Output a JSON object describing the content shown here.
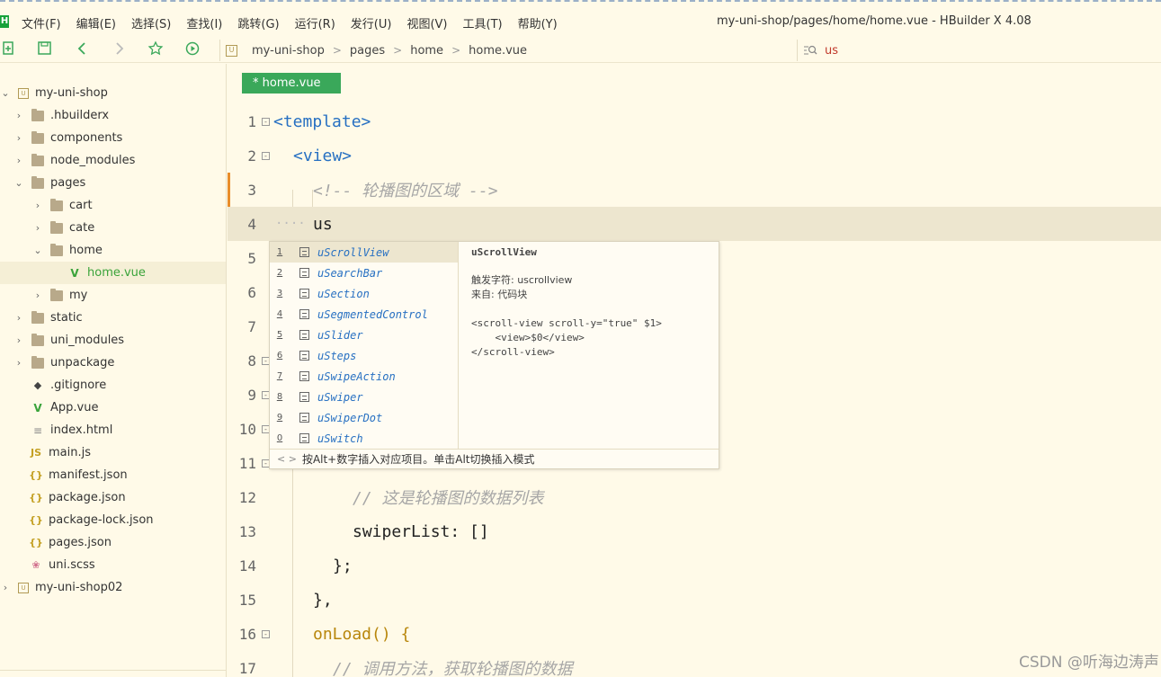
{
  "window": {
    "title": "my-uni-shop/pages/home/home.vue - HBuilder X 4.08",
    "menu": [
      "文件(F)",
      "编辑(E)",
      "选择(S)",
      "查找(I)",
      "跳转(G)",
      "运行(R)",
      "发行(U)",
      "视图(V)",
      "工具(T)",
      "帮助(Y)"
    ]
  },
  "breadcrumb": [
    "my-uni-shop",
    "pages",
    "home",
    "home.vue"
  ],
  "search": {
    "value": "us"
  },
  "sidebar": {
    "items": [
      {
        "label": "my-uni-shop",
        "icon": "project-icon",
        "chevron": "v"
      },
      {
        "label": ".hbuilderx",
        "icon": "folder-icon",
        "chevron": ">"
      },
      {
        "label": "components",
        "icon": "folder-icon",
        "chevron": ">"
      },
      {
        "label": "node_modules",
        "icon": "folder-icon",
        "chevron": ">"
      },
      {
        "label": "pages",
        "icon": "folder-icon",
        "chevron": "v"
      },
      {
        "label": "cart",
        "icon": "folder-icon",
        "chevron": ">"
      },
      {
        "label": "cate",
        "icon": "folder-icon",
        "chevron": ">"
      },
      {
        "label": "home",
        "icon": "folder-icon",
        "chevron": "v"
      },
      {
        "label": "home.vue",
        "icon": "vue-icon",
        "chevron": ""
      },
      {
        "label": "my",
        "icon": "folder-icon",
        "chevron": ">"
      },
      {
        "label": "static",
        "icon": "folder-icon",
        "chevron": ">"
      },
      {
        "label": "uni_modules",
        "icon": "folder-icon",
        "chevron": ">"
      },
      {
        "label": "unpackage",
        "icon": "folder-icon",
        "chevron": ">"
      },
      {
        "label": ".gitignore",
        "icon": "git-icon",
        "chevron": ""
      },
      {
        "label": "App.vue",
        "icon": "vue-icon",
        "chevron": ""
      },
      {
        "label": "index.html",
        "icon": "html-icon",
        "chevron": ""
      },
      {
        "label": "main.js",
        "icon": "js-icon",
        "chevron": ""
      },
      {
        "label": "manifest.json",
        "icon": "json-icon",
        "chevron": ""
      },
      {
        "label": "package.json",
        "icon": "json-icon",
        "chevron": ""
      },
      {
        "label": "package-lock.json",
        "icon": "json-icon",
        "chevron": ""
      },
      {
        "label": "pages.json",
        "icon": "json-icon",
        "chevron": ""
      },
      {
        "label": "uni.scss",
        "icon": "scss-icon",
        "chevron": ""
      },
      {
        "label": "my-uni-shop02",
        "icon": "project-icon",
        "chevron": ">"
      }
    ]
  },
  "editor": {
    "tab_label": "* home.vue",
    "lines": [
      {
        "num": "1",
        "text": "<template>"
      },
      {
        "num": "2",
        "text": "<view>"
      },
      {
        "num": "3",
        "text": "<!-- 轮播图的区域 -->"
      },
      {
        "num": "4",
        "text": "us"
      },
      {
        "num": "5",
        "text": ""
      },
      {
        "num": "6",
        "text": ""
      },
      {
        "num": "7",
        "text": ""
      },
      {
        "num": "8",
        "text": ""
      },
      {
        "num": "9",
        "text": ""
      },
      {
        "num": "10",
        "text": ""
      },
      {
        "num": "11",
        "text": ""
      },
      {
        "num": "12",
        "text": "// 这是轮播图的数据列表"
      },
      {
        "num": "13",
        "text": "swiperList: []"
      },
      {
        "num": "14",
        "text": "};"
      },
      {
        "num": "15",
        "text": "},"
      },
      {
        "num": "16",
        "text": "onLoad() {"
      },
      {
        "num": "17",
        "text": "// 调用方法，获取轮播图的数据"
      }
    ]
  },
  "autocomplete": {
    "items": [
      {
        "num": "1",
        "label": "uScrollView"
      },
      {
        "num": "2",
        "label": "uSearchBar"
      },
      {
        "num": "3",
        "label": "uSection"
      },
      {
        "num": "4",
        "label": "uSegmentedControl"
      },
      {
        "num": "5",
        "label": "uSlider"
      },
      {
        "num": "6",
        "label": "uSteps"
      },
      {
        "num": "7",
        "label": "uSwipeAction"
      },
      {
        "num": "8",
        "label": "uSwiper"
      },
      {
        "num": "9",
        "label": "uSwiperDot"
      },
      {
        "num": "0",
        "label": "uSwitch"
      }
    ],
    "detail": {
      "title": "uScrollView",
      "trigger": "触发字符: uscrollview",
      "source": "来自: 代码块",
      "snippet": [
        "<scroll-view scroll-y=\"true\" $1>",
        "    <view>$0</view>",
        "</scroll-view>"
      ]
    },
    "footer": "按Alt+数字插入对应项目。单击Alt切换插入模式"
  },
  "watermark": "CSDN @听海边涛声",
  "colors": {
    "accent": "#3aa85a",
    "tag": "#2770c2",
    "comment": "#a6a6a6",
    "background": "#fffae8"
  }
}
